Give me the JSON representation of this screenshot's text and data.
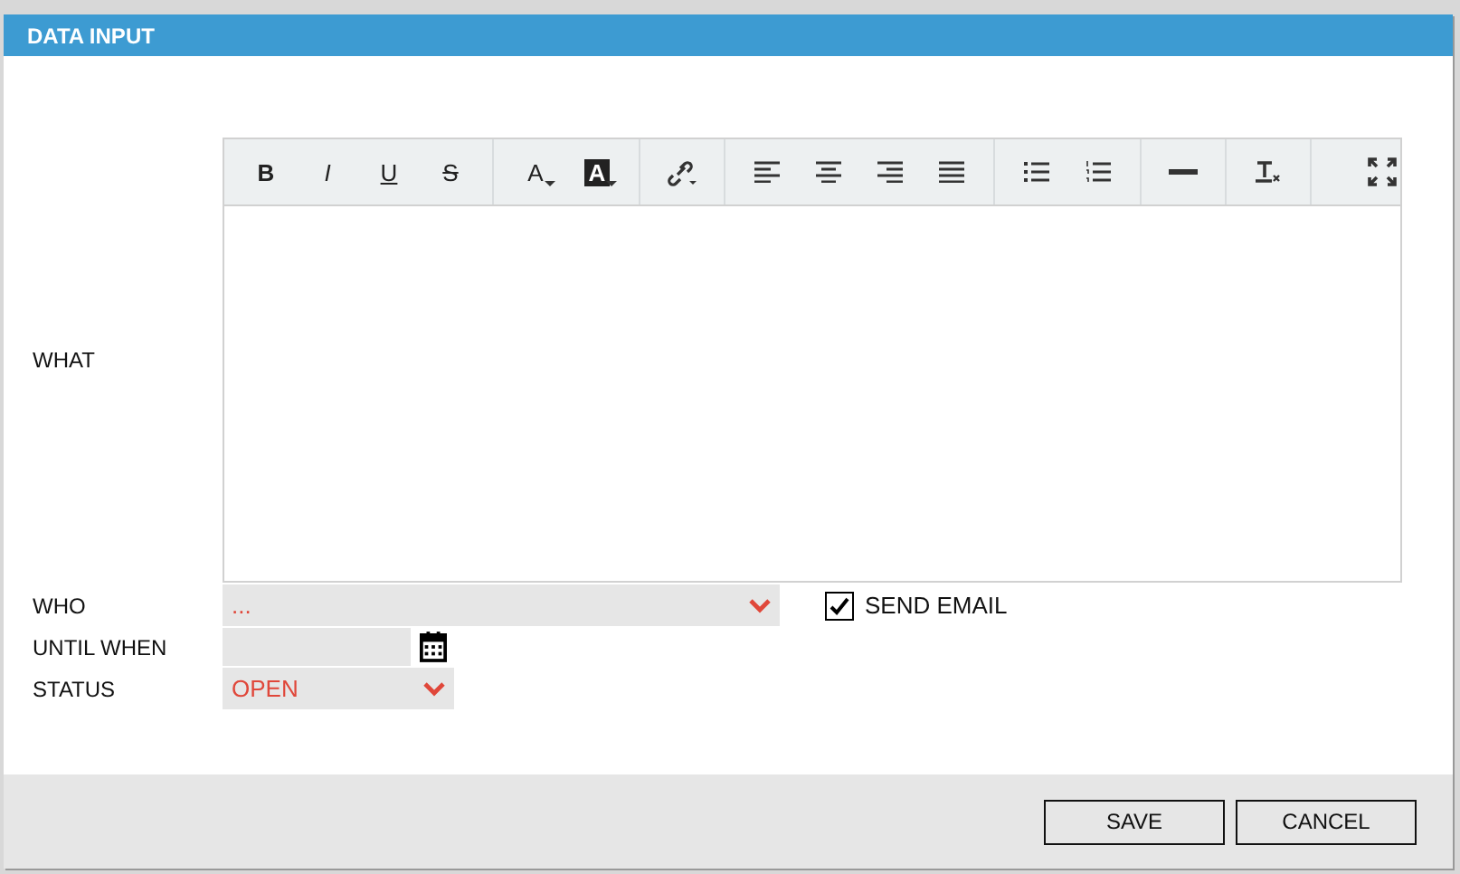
{
  "dialog": {
    "title": "DATA INPUT"
  },
  "editor": {
    "label": "WHAT",
    "toolbar": [
      [
        {
          "kind": "bold",
          "label": "B"
        },
        {
          "kind": "italic",
          "label": "I"
        },
        {
          "kind": "underline",
          "label": "U"
        },
        {
          "kind": "strike",
          "label": "S"
        }
      ],
      [
        {
          "kind": "text-color",
          "label": "A"
        },
        {
          "kind": "bg-color",
          "label": "A"
        }
      ],
      [
        {
          "kind": "link"
        }
      ],
      [
        {
          "kind": "align-left"
        },
        {
          "kind": "align-center"
        },
        {
          "kind": "align-right"
        },
        {
          "kind": "justify"
        }
      ],
      [
        {
          "kind": "bullets"
        },
        {
          "kind": "numbers"
        }
      ],
      [
        {
          "kind": "rule"
        }
      ],
      [
        {
          "kind": "clear"
        }
      ],
      [
        {
          "kind": "maximize"
        }
      ]
    ]
  },
  "who": {
    "label": "WHO",
    "value": "..."
  },
  "send_email": {
    "label": "SEND EMAIL",
    "checked": true
  },
  "until_when": {
    "label": "UNTIL WHEN"
  },
  "status": {
    "label": "STATUS",
    "value": "OPEN"
  },
  "buttons": [
    "SAVE",
    "CANCEL"
  ]
}
